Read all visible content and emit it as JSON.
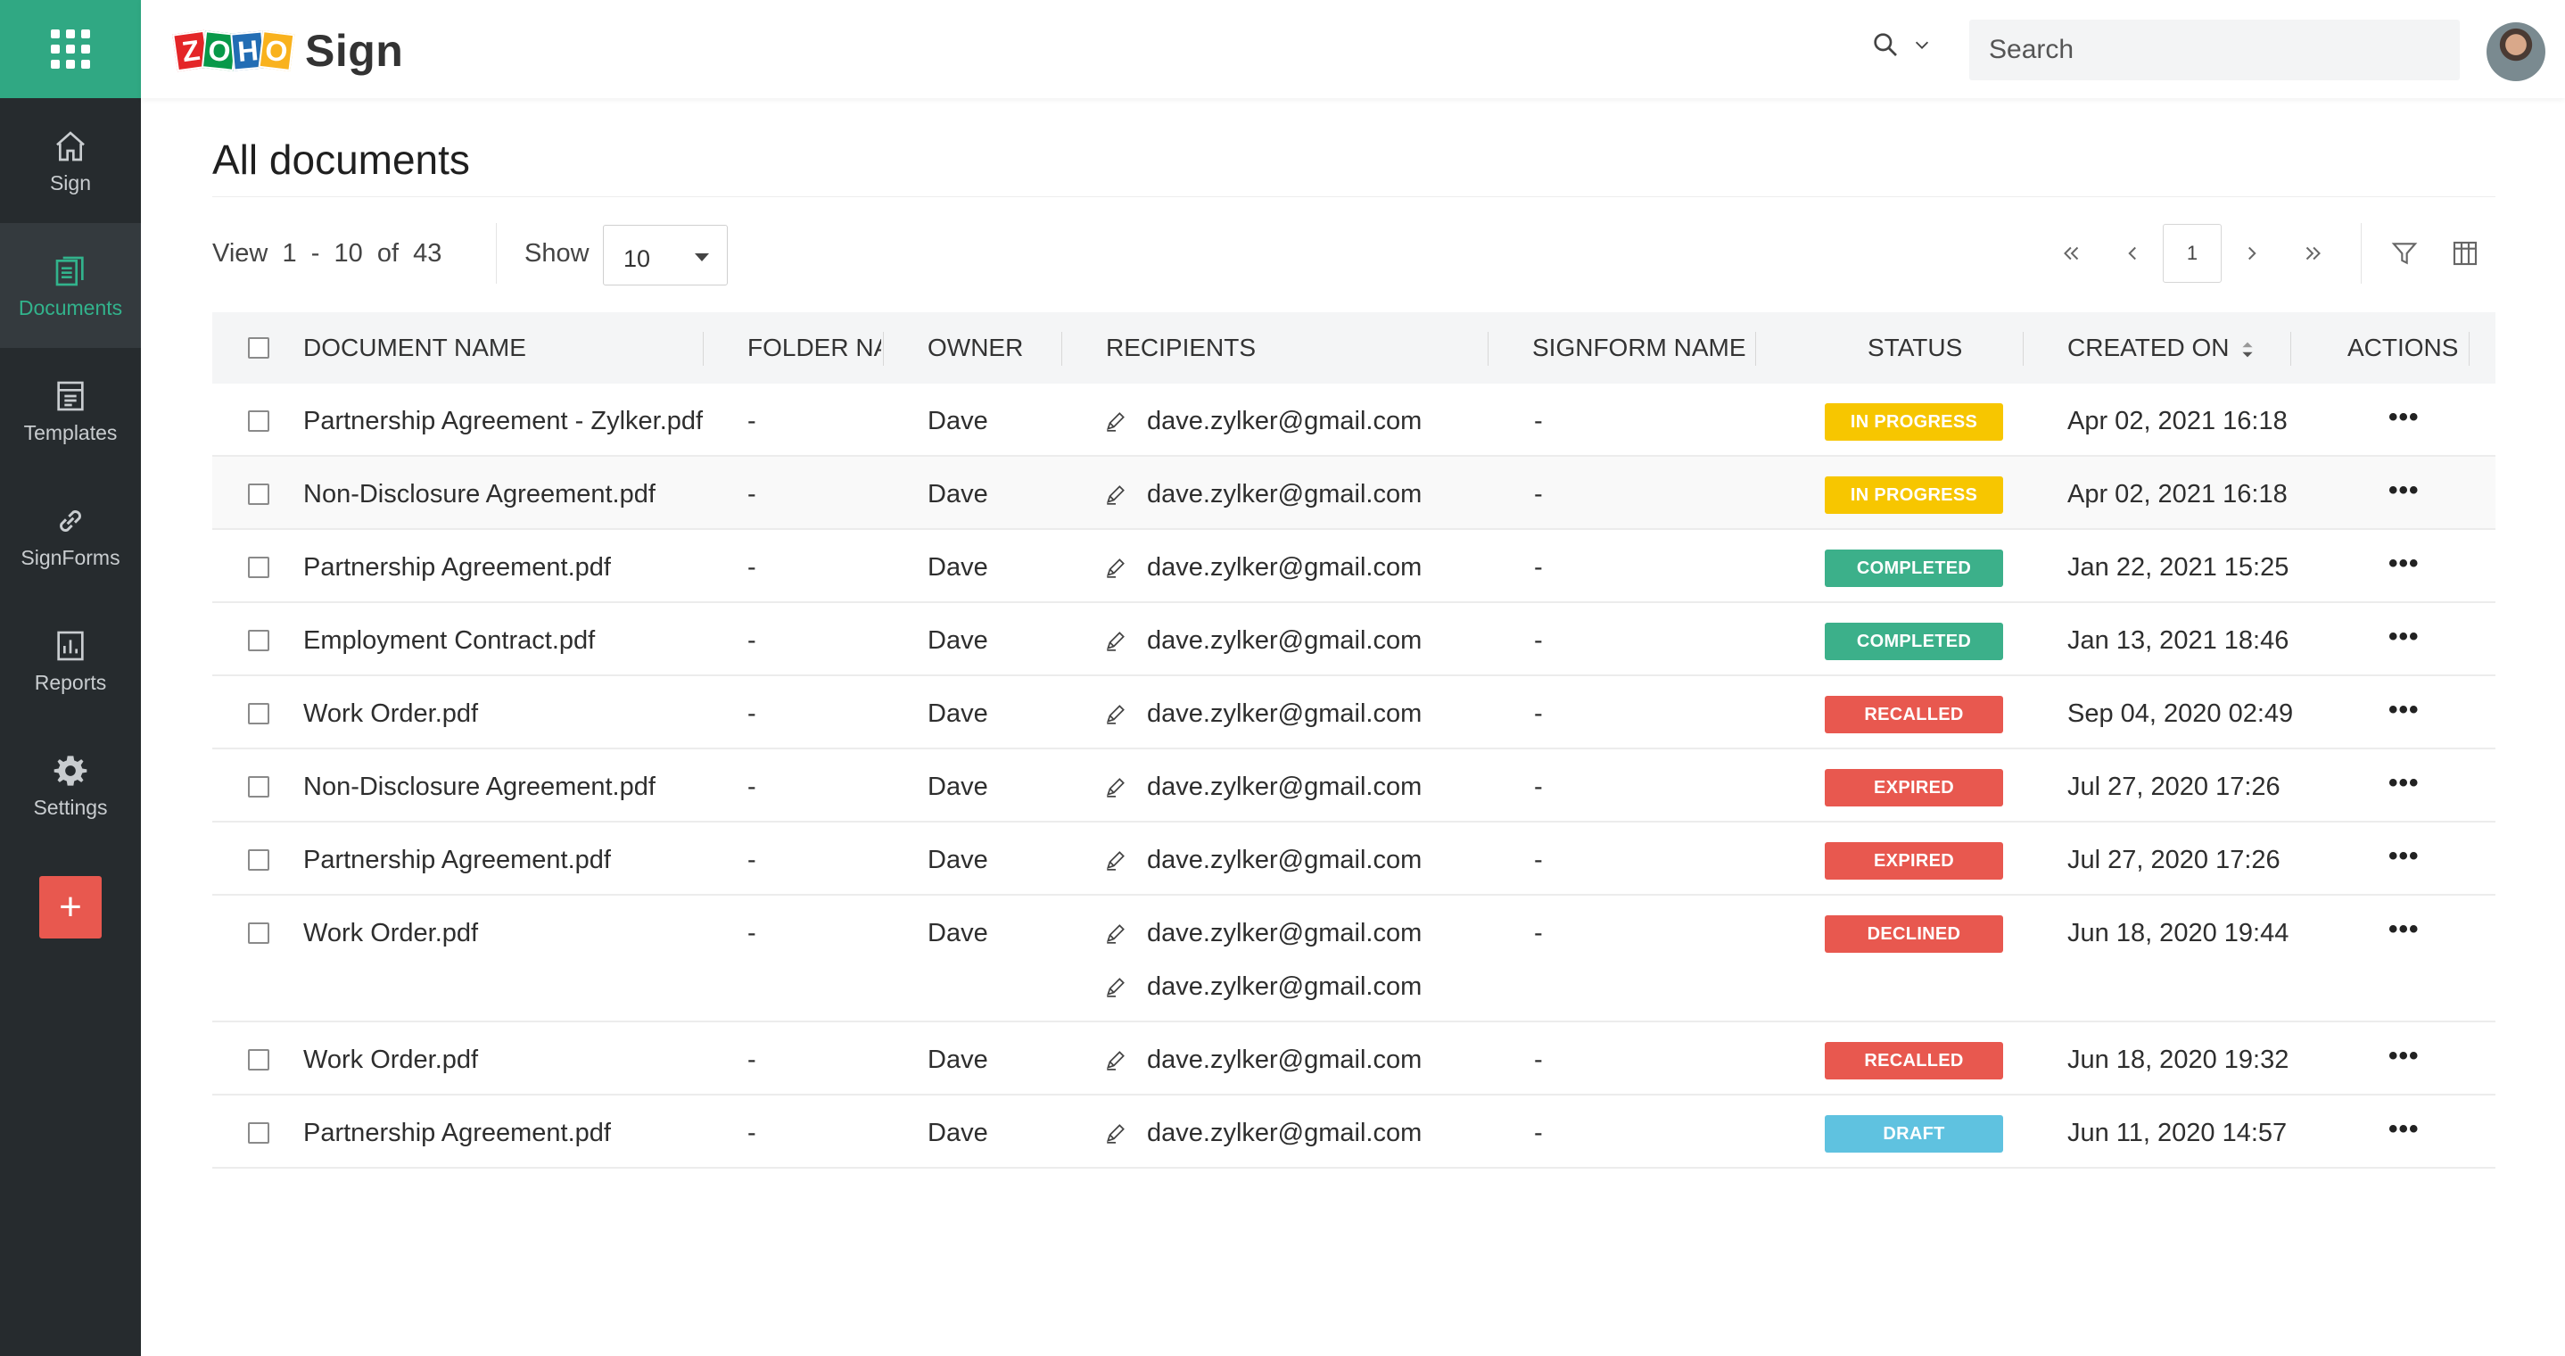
{
  "app": {
    "name": "Sign",
    "logo_letters": [
      "Z",
      "O",
      "H",
      "O"
    ]
  },
  "sidebar": {
    "items": [
      {
        "label": "Sign",
        "icon": "home-icon"
      },
      {
        "label": "Documents",
        "icon": "documents-icon"
      },
      {
        "label": "Templates",
        "icon": "templates-icon"
      },
      {
        "label": "SignForms",
        "icon": "link-icon"
      },
      {
        "label": "Reports",
        "icon": "reports-icon"
      },
      {
        "label": "Settings",
        "icon": "gear-icon"
      }
    ],
    "active": "Documents",
    "add_label": "+"
  },
  "header": {
    "search_placeholder": "Search"
  },
  "page": {
    "title": "All documents"
  },
  "toolbar": {
    "view_text": "View  1  -  10  of  43",
    "show_label": "Show",
    "show_value": "10",
    "page_number": "1"
  },
  "table": {
    "columns": {
      "document_name": "DOCUMENT NAME",
      "folder_name": "FOLDER NA",
      "owner": "OWNER",
      "recipients": "RECIPIENTS",
      "signform_name": "SIGNFORM NAME",
      "status": "STATUS",
      "created_on": "CREATED ON",
      "actions": "ACTIONS"
    },
    "rows": [
      {
        "name": "Partnership Agreement - Zylker.pdf",
        "folder": "-",
        "owner": "Dave",
        "recipients": [
          "dave.zylker@gmail.com"
        ],
        "signform": "-",
        "status": "IN PROGRESS",
        "created": "Apr 02, 2021 16:18",
        "actions": "•••"
      },
      {
        "name": "Non-Disclosure Agreement.pdf",
        "folder": "-",
        "owner": "Dave",
        "recipients": [
          "dave.zylker@gmail.com"
        ],
        "signform": "-",
        "status": "IN PROGRESS",
        "created": "Apr 02, 2021 16:18",
        "actions": "•••"
      },
      {
        "name": "Partnership Agreement.pdf",
        "folder": "-",
        "owner": "Dave",
        "recipients": [
          "dave.zylker@gmail.com"
        ],
        "signform": "-",
        "status": "COMPLETED",
        "created": "Jan 22, 2021 15:25",
        "actions": "•••"
      },
      {
        "name": "Employment Contract.pdf",
        "folder": "-",
        "owner": "Dave",
        "recipients": [
          "dave.zylker@gmail.com"
        ],
        "signform": "-",
        "status": "COMPLETED",
        "created": "Jan 13, 2021 18:46",
        "actions": "•••"
      },
      {
        "name": "Work Order.pdf",
        "folder": "-",
        "owner": "Dave",
        "recipients": [
          "dave.zylker@gmail.com"
        ],
        "signform": "-",
        "status": "RECALLED",
        "created": "Sep 04, 2020 02:49",
        "actions": "•••"
      },
      {
        "name": "Non-Disclosure Agreement.pdf",
        "folder": "-",
        "owner": "Dave",
        "recipients": [
          "dave.zylker@gmail.com"
        ],
        "signform": "-",
        "status": "EXPIRED",
        "created": "Jul 27, 2020 17:26",
        "actions": "•••"
      },
      {
        "name": "Partnership Agreement.pdf",
        "folder": "-",
        "owner": "Dave",
        "recipients": [
          "dave.zylker@gmail.com"
        ],
        "signform": "-",
        "status": "EXPIRED",
        "created": "Jul 27, 2020 17:26",
        "actions": "•••"
      },
      {
        "name": "Work Order.pdf",
        "folder": "-",
        "owner": "Dave",
        "recipients": [
          "dave.zylker@gmail.com",
          "dave.zylker@gmail.com"
        ],
        "signform": "-",
        "status": "DECLINED",
        "created": "Jun 18, 2020 19:44",
        "actions": "•••"
      },
      {
        "name": "Work Order.pdf",
        "folder": "-",
        "owner": "Dave",
        "recipients": [
          "dave.zylker@gmail.com"
        ],
        "signform": "-",
        "status": "RECALLED",
        "created": "Jun 18, 2020 19:32",
        "actions": "•••"
      },
      {
        "name": "Partnership Agreement.pdf",
        "folder": "-",
        "owner": "Dave",
        "recipients": [
          "dave.zylker@gmail.com"
        ],
        "signform": "-",
        "status": "DRAFT",
        "created": "Jun 11, 2020 14:57",
        "actions": "•••"
      }
    ]
  },
  "colors": {
    "accent": "#30a883",
    "sidebar_bg": "#262b2e",
    "add_button": "#e8584f",
    "status": {
      "IN PROGRESS": "#f7c600",
      "COMPLETED": "#3cb08a",
      "RECALLED": "#e8584f",
      "EXPIRED": "#e8584f",
      "DECLINED": "#e8584f",
      "DRAFT": "#5fc2e0"
    }
  }
}
